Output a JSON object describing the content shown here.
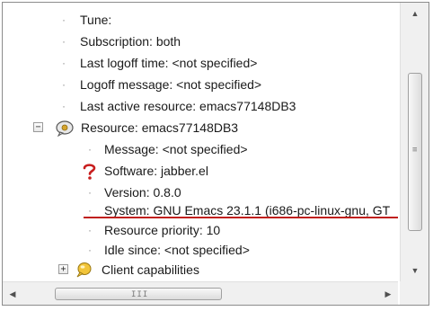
{
  "tree": {
    "items": [
      {
        "label": "Tune:",
        "kind": "leaf-level2"
      },
      {
        "label": "Subscription: both",
        "kind": "leaf-level2"
      },
      {
        "label": "Last logoff time: <not specified>",
        "kind": "leaf-level2"
      },
      {
        "label": "Logoff message: <not specified>",
        "kind": "leaf-level2"
      },
      {
        "label": "Last active resource: emacs77148DB3",
        "kind": "leaf-level2"
      },
      {
        "label": "Resource: emacs77148DB3",
        "kind": "expanded-node",
        "expander": "⊟",
        "icon": "speech-bubble-icon"
      },
      {
        "label": "Message: <not specified>",
        "kind": "leaf-level3"
      },
      {
        "label": "Software: jabber.el",
        "kind": "leaf-level3",
        "icon": "question-mark-icon"
      },
      {
        "label": "Version: 0.8.0",
        "kind": "leaf-level3"
      },
      {
        "label": "System: GNU Emacs 23.1.1 (i686-pc-linux-gnu, GT",
        "kind": "leaf-level3",
        "underline_color": "#c0201b"
      },
      {
        "label": "Resource priority: 10",
        "kind": "leaf-level3"
      },
      {
        "label": "Idle since: <not specified>",
        "kind": "leaf-level3"
      },
      {
        "label": "Client capabilities",
        "kind": "collapsed-node",
        "expander": "⊞",
        "icon": "lightbulb-icon"
      }
    ]
  },
  "scrollbars": {
    "vertical": {
      "up_glyph": "▲",
      "down_glyph": "▼",
      "grip_glyph": "≡"
    },
    "horizontal": {
      "left_glyph": "◀",
      "right_glyph": "▶",
      "grip_glyph": "III"
    }
  },
  "colors": {
    "bullet": "#909090",
    "underline": "#c0201b",
    "scrollbar_bg": "#f0f0f0"
  }
}
